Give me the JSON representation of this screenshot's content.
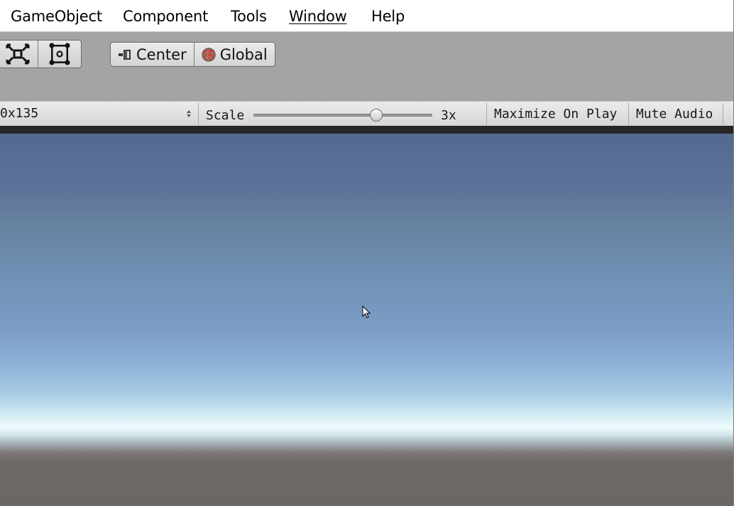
{
  "menu": {
    "items": [
      {
        "label": "GameObject"
      },
      {
        "label": "Component"
      },
      {
        "label": "Tools"
      },
      {
        "label": "Window"
      },
      {
        "label": "Help"
      }
    ]
  },
  "toolbar": {
    "pivot_mode_label": "Center",
    "pivot_rotation_label": "Global",
    "tools": [
      "scale-tool-icon",
      "rect-tool-icon"
    ]
  },
  "game_view": {
    "resolution_value": "0x135",
    "scale_label": "Scale",
    "scale_value_label": "3x",
    "scale_level": 0.7,
    "maximize_on_play_label": "Maximize On Play",
    "mute_audio_label": "Mute Audio"
  },
  "colors": {
    "sky_top": "#556990",
    "horizon": "#eefafc",
    "ground": "#6c6664"
  }
}
